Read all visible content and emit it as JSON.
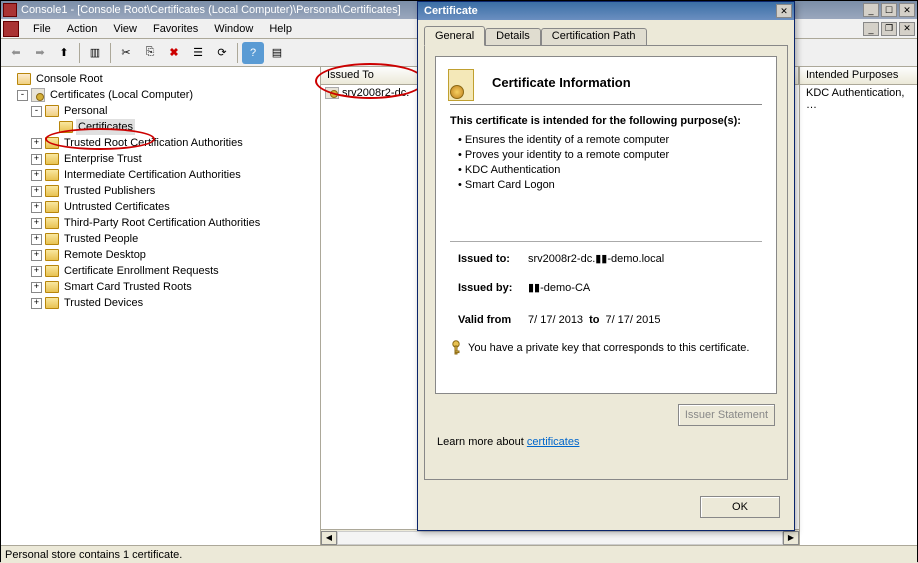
{
  "window": {
    "title": "Console1 - [Console Root\\Certificates (Local Computer)\\Personal\\Certificates]"
  },
  "menu": [
    "File",
    "Action",
    "View",
    "Favorites",
    "Window",
    "Help"
  ],
  "tree": {
    "root": "Console Root",
    "certs_node": "Certificates (Local Computer)",
    "personal": "Personal",
    "certificates": "Certificates",
    "items": [
      "Trusted Root Certification Authorities",
      "Enterprise Trust",
      "Intermediate Certification Authorities",
      "Trusted Publishers",
      "Untrusted Certificates",
      "Third-Party Root Certification Authorities",
      "Trusted People",
      "Remote Desktop",
      "Certificate Enrollment Requests",
      "Smart Card Trusted Roots",
      "Trusted Devices"
    ]
  },
  "list": {
    "col_issued_to": "Issued To",
    "row0": "srv2008r2-dc."
  },
  "right": {
    "header": "Intended Purposes",
    "row0": "KDC Authentication, …"
  },
  "status": "Personal store contains 1 certificate.",
  "dialog": {
    "title": "Certificate",
    "tabs": {
      "general": "General",
      "details": "Details",
      "certpath": "Certification Path"
    },
    "heading": "Certificate Information",
    "purpose_title": "This certificate is intended for the following purpose(s):",
    "purposes": [
      "Ensures the identity of a remote computer",
      "Proves your identity to a remote computer",
      "KDC Authentication",
      "Smart Card Logon"
    ],
    "issued_to_label": "Issued to:",
    "issued_to_value": "srv2008r2-dc.▮▮-demo.local",
    "issued_by_label": "Issued by:",
    "issued_by_value": "▮▮-demo-CA",
    "valid_from_label": "Valid from",
    "valid_from": "7/ 17/ 2013",
    "valid_to_label": "to",
    "valid_to": "7/ 17/ 2015",
    "privkey": "You have a private key that corresponds to this certificate.",
    "issuer_stmt": "Issuer Statement",
    "learn_prefix": "Learn more about ",
    "learn_link": "certificates",
    "ok": "OK"
  }
}
